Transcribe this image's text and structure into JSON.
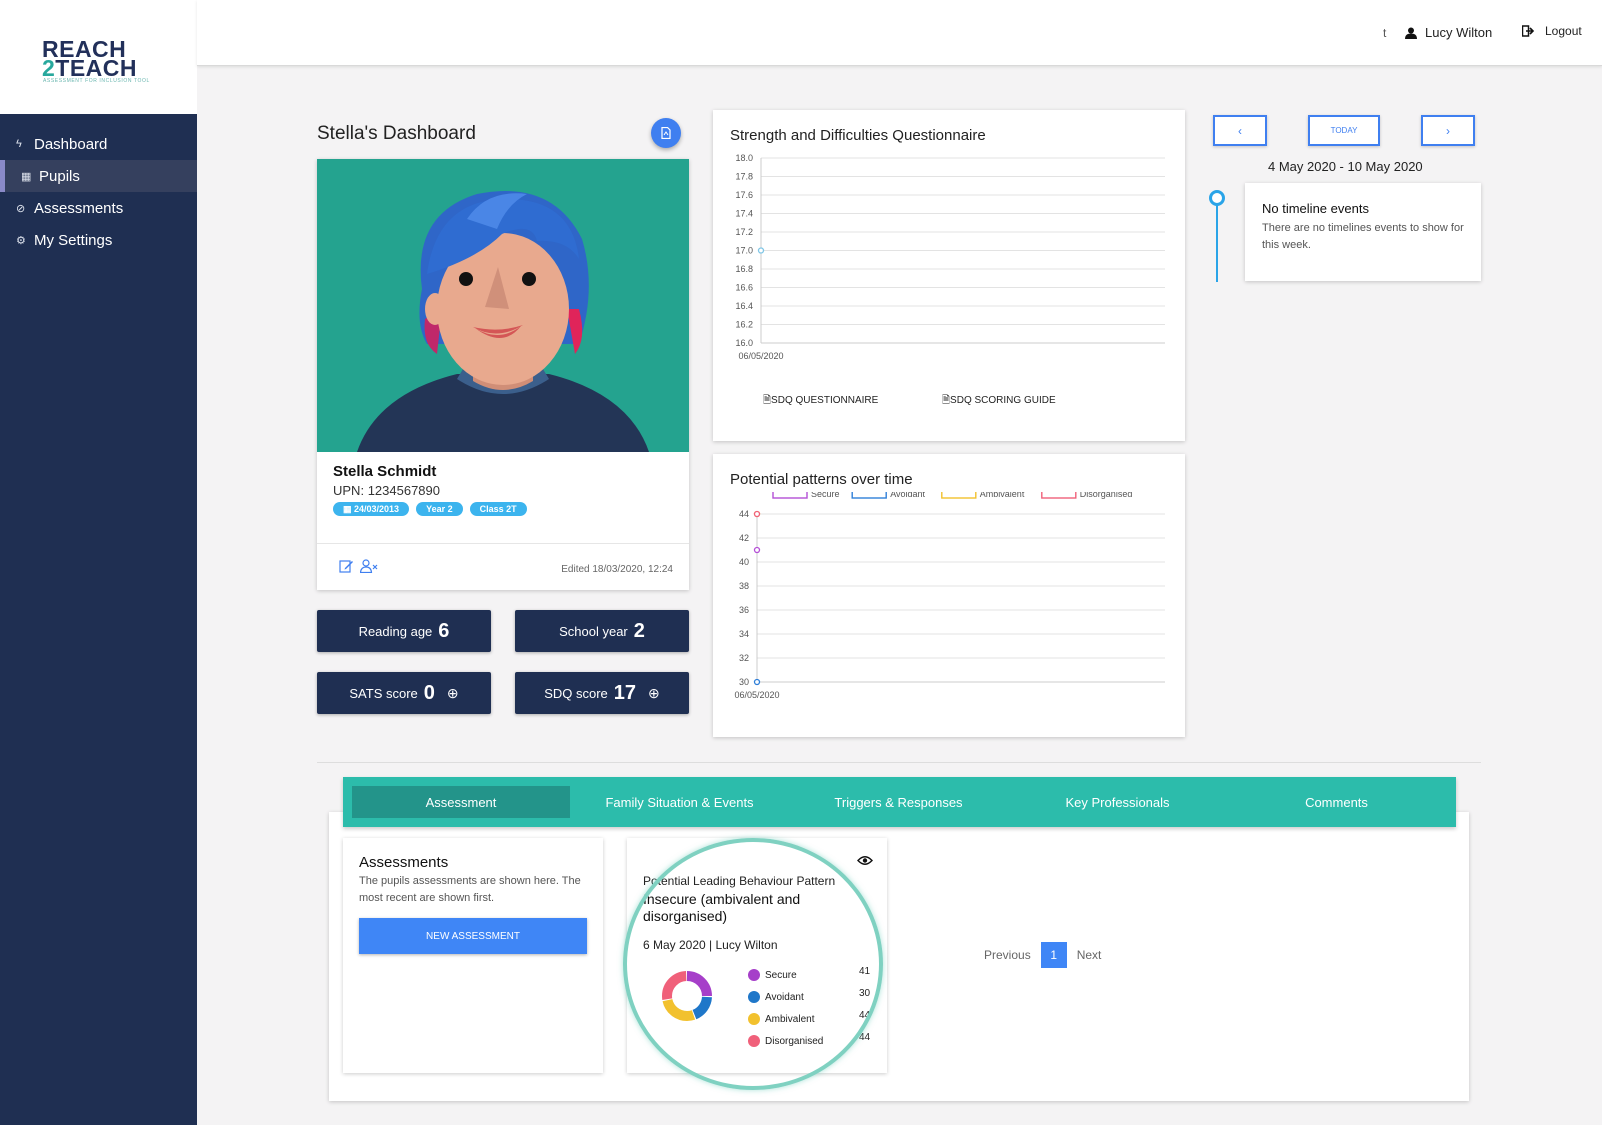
{
  "brand": {
    "line1": "REACH",
    "line2_num": "2",
    "line2": "TEACH",
    "tagline": "ASSESSMENT FOR INCLUSION TOOL"
  },
  "sidebar": {
    "items": [
      {
        "label": "Dashboard",
        "icon": "bolt-icon"
      },
      {
        "label": "Pupils",
        "icon": "calendar-icon"
      },
      {
        "label": "Assessments",
        "icon": "compass-icon"
      },
      {
        "label": "My Settings",
        "icon": "gear-icon"
      }
    ]
  },
  "topbar": {
    "truncated": "t",
    "user": "Lucy Wilton",
    "logout": "Logout"
  },
  "page": {
    "title": "Stella's Dashboard"
  },
  "pupil": {
    "name": "Stella Schmidt",
    "upn_label": "UPN:",
    "upn": "1234567890",
    "dob": "24/03/2013",
    "year": "Year 2",
    "class": "Class 2T",
    "edited": "Edited 18/03/2020, 12:24"
  },
  "stats": {
    "reading_label": "Reading age",
    "reading_value": "6",
    "school_label": "School year",
    "school_value": "2",
    "sats_label": "SATS score",
    "sats_value": "0",
    "sdq_label": "SDQ score",
    "sdq_value": "17"
  },
  "sdq_chart": {
    "title": "Strength and Difficulties Questionnaire",
    "questionnaire_link": "SDQ QUESTIONNAIRE",
    "guide_link": "SDQ SCORING GUIDE"
  },
  "patterns_chart": {
    "title": "Potential patterns over time"
  },
  "chart_data": [
    {
      "type": "line",
      "title": "Strength and Difficulties Questionnaire",
      "x": [
        "06/05/2020"
      ],
      "series": [
        {
          "values": [
            17.0
          ]
        }
      ],
      "ylim": [
        16.0,
        18.0
      ],
      "yticks": [
        "18.0",
        "17.8",
        "17.6",
        "17.4",
        "17.2",
        "17.0",
        "16.8",
        "16.6",
        "16.4",
        "16.2",
        "16.0"
      ],
      "grid": true
    },
    {
      "type": "line",
      "title": "Potential patterns over time",
      "x": [
        "06/05/2020"
      ],
      "series": [
        {
          "name": "Secure",
          "values": [
            41
          ],
          "color": "#b44fd6"
        },
        {
          "name": "Avoidant",
          "values": [
            30
          ],
          "color": "#2f7fd8"
        },
        {
          "name": "Ambivalent",
          "values": [
            44
          ],
          "color": "#f2c12e"
        },
        {
          "name": "Disorganised",
          "values": [
            44
          ],
          "color": "#f0607a"
        }
      ],
      "ylim": [
        30,
        44
      ],
      "yticks": [
        "44",
        "42",
        "40",
        "38",
        "36",
        "34",
        "32",
        "30"
      ],
      "legend": "top",
      "grid": true
    },
    {
      "type": "pie",
      "labels": [
        "Secure",
        "Avoidant",
        "Ambivalent",
        "Disorganised"
      ],
      "values": [
        41,
        30,
        44,
        44
      ],
      "colors": [
        "#a63fc9",
        "#1f77c9",
        "#f2c12e",
        "#f0607a"
      ]
    }
  ],
  "timeline": {
    "prev_icon": "chevron-left-icon",
    "today": "TODAY",
    "next_icon": "chevron-right-icon",
    "range": "4 May 2020 - 10 May 2020",
    "empty_title": "No timeline events",
    "empty_text": "There are no timelines events to show for this week."
  },
  "tabs": [
    "Assessment",
    "Family Situation & Events",
    "Triggers & Responses",
    "Key Professionals",
    "Comments"
  ],
  "assessments": {
    "title": "Assessments",
    "subtitle": "The pupils assessments are shown here. The most recent are shown first.",
    "new_button": "NEW ASSESSMENT"
  },
  "pattern_card": {
    "heading": "Potential Leading Behaviour Pattern",
    "pattern": "Insecure (ambivalent and disorganised)",
    "date": "6 May 2020 | Lucy Wilton",
    "legend": [
      {
        "label": "Secure",
        "value": "41",
        "color": "#a63fc9"
      },
      {
        "label": "Avoidant",
        "value": "30",
        "color": "#1f77c9"
      },
      {
        "label": "Ambivalent",
        "value": "44",
        "color": "#f2c12e"
      },
      {
        "label": "Disorganised",
        "value": "44",
        "color": "#f0607a"
      }
    ]
  },
  "pagination": {
    "previous": "Previous",
    "page": "1",
    "next": "Next"
  }
}
